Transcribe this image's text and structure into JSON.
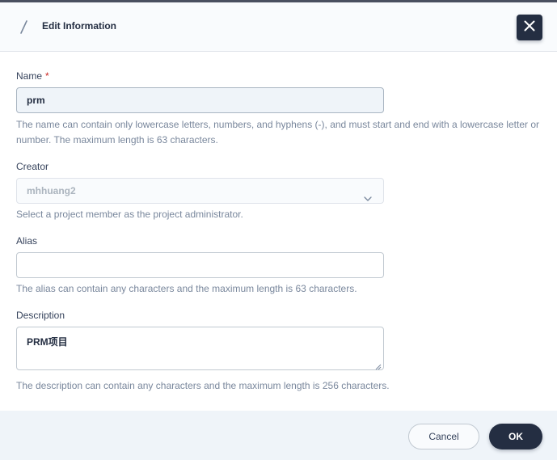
{
  "dialog": {
    "title": "Edit Information",
    "header_icon": "pencil-icon",
    "close_icon": "close-icon"
  },
  "form": {
    "name": {
      "label": "Name",
      "required_mark": "*",
      "value": "prm",
      "hint": "The name can contain only lowercase letters, numbers, and hyphens (-), and must start and end with a lowercase letter or number. The maximum length is 63 characters."
    },
    "creator": {
      "label": "Creator",
      "value": "mhhuang2",
      "hint": "Select a project member as the project administrator.",
      "icon": "chevron-down-icon"
    },
    "alias": {
      "label": "Alias",
      "value": "",
      "hint": "The alias can contain any characters and the maximum length is 63 characters."
    },
    "description": {
      "label": "Description",
      "value": "PRM项目",
      "hint": "The description can contain any characters and the maximum length is 256 characters."
    }
  },
  "footer": {
    "cancel_label": "Cancel",
    "ok_label": "OK"
  },
  "colors": {
    "primary_dark": "#242e42",
    "required": "#ca2621",
    "hint_text": "#79879c",
    "footer_bg": "#eff4f9"
  }
}
